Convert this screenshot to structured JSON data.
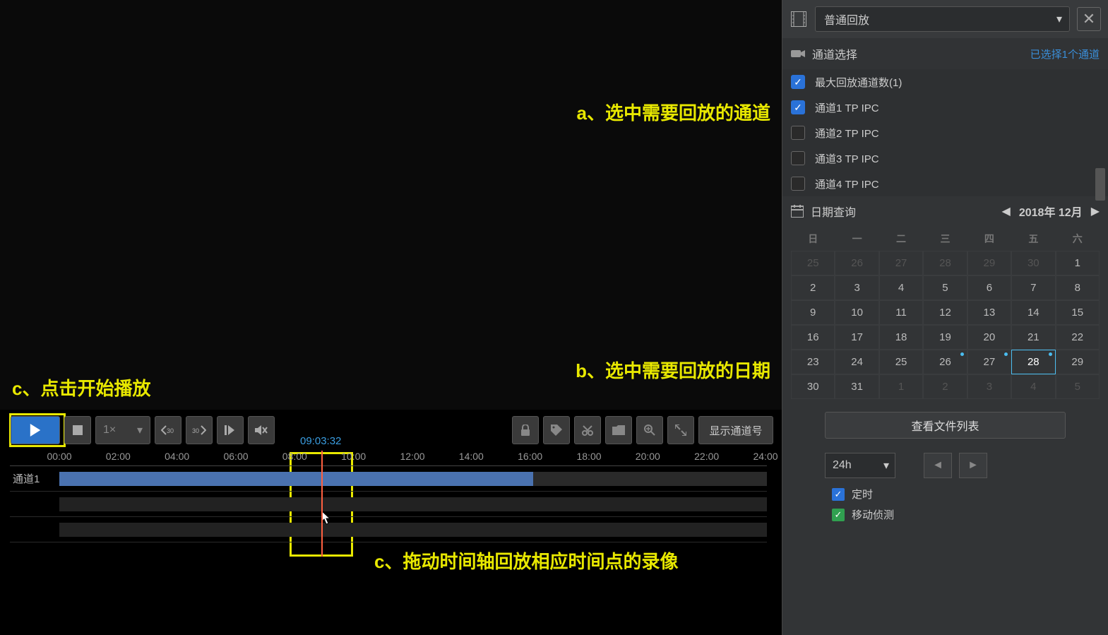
{
  "annotations": {
    "a": "a、选中需要回放的通道",
    "b": "b、选中需要回放的日期",
    "c1": "c、点击开始播放",
    "c2": "c、拖动时间轴回放相应时间点的录像"
  },
  "toolbar": {
    "speed": "1×",
    "show_channel": "显示通道号"
  },
  "timeline": {
    "ticks": [
      "00:00",
      "02:00",
      "04:00",
      "06:00",
      "08:00",
      "10:00",
      "12:00",
      "14:00",
      "16:00",
      "18:00",
      "20:00",
      "22:00",
      "24:00"
    ],
    "track_label": "通道1",
    "playhead_time": "09:03:32"
  },
  "side": {
    "mode": "普通回放",
    "channel_section_title": "通道选择",
    "channel_selected_hint": "已选择1个通道",
    "max_channels": "最大回放通道数(1)",
    "channels": [
      {
        "label": "通道1 TP IPC",
        "checked": true
      },
      {
        "label": "通道2 TP IPC",
        "checked": false
      },
      {
        "label": "通道3 TP IPC",
        "checked": false
      },
      {
        "label": "通道4 TP IPC",
        "checked": false
      }
    ],
    "date_section_title": "日期查询",
    "month_label": "2018年 12月",
    "dow": [
      "日",
      "一",
      "二",
      "三",
      "四",
      "五",
      "六"
    ],
    "weeks": [
      [
        {
          "d": "25",
          "dim": true
        },
        {
          "d": "26",
          "dim": true
        },
        {
          "d": "27",
          "dim": true
        },
        {
          "d": "28",
          "dim": true
        },
        {
          "d": "29",
          "dim": true
        },
        {
          "d": "30",
          "dim": true
        },
        {
          "d": "1"
        }
      ],
      [
        {
          "d": "2"
        },
        {
          "d": "3"
        },
        {
          "d": "4"
        },
        {
          "d": "5"
        },
        {
          "d": "6"
        },
        {
          "d": "7"
        },
        {
          "d": "8"
        }
      ],
      [
        {
          "d": "9"
        },
        {
          "d": "10"
        },
        {
          "d": "11"
        },
        {
          "d": "12"
        },
        {
          "d": "13"
        },
        {
          "d": "14"
        },
        {
          "d": "15"
        }
      ],
      [
        {
          "d": "16"
        },
        {
          "d": "17"
        },
        {
          "d": "18"
        },
        {
          "d": "19"
        },
        {
          "d": "20"
        },
        {
          "d": "21"
        },
        {
          "d": "22"
        }
      ],
      [
        {
          "d": "23"
        },
        {
          "d": "24"
        },
        {
          "d": "25"
        },
        {
          "d": "26",
          "dot": true
        },
        {
          "d": "27",
          "dot": true
        },
        {
          "d": "28",
          "dot": true,
          "sel": true
        },
        {
          "d": "29"
        }
      ],
      [
        {
          "d": "30"
        },
        {
          "d": "31"
        },
        {
          "d": "1",
          "dim": true
        },
        {
          "d": "2",
          "dim": true
        },
        {
          "d": "3",
          "dim": true
        },
        {
          "d": "4",
          "dim": true
        },
        {
          "d": "5",
          "dim": true
        }
      ]
    ],
    "file_list_btn": "查看文件列表",
    "range": "24h",
    "filters": {
      "timed": "定时",
      "motion": "移动侦测"
    }
  }
}
